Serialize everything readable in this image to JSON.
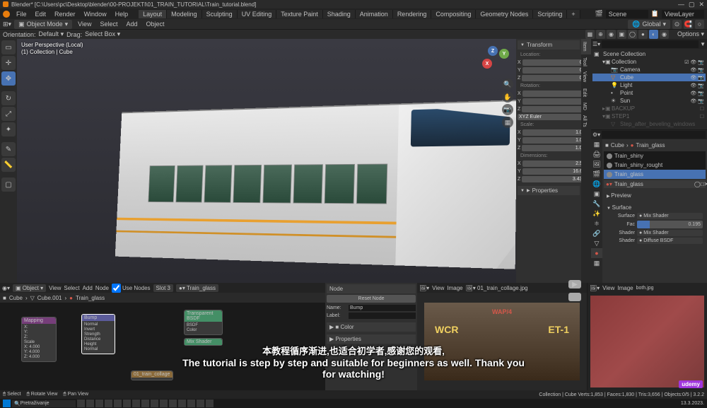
{
  "titlebar": {
    "path": "Blender* [C:\\Users\\pc\\Desktop\\blender\\00-PROJEKTI\\01_TRAIN_TUTORIAL\\Train_tutorial.blend]"
  },
  "topmenu": {
    "items": [
      "File",
      "Edit",
      "Render",
      "Window",
      "Help"
    ],
    "tabs": [
      "Layout",
      "Modeling",
      "Sculpting",
      "UV Editing",
      "Texture Paint",
      "Shading",
      "Animation",
      "Rendering",
      "Compositing",
      "Geometry Nodes",
      "Scripting"
    ],
    "active_tab": "Layout",
    "scene_label": "Scene",
    "viewlayer_label": "ViewLayer"
  },
  "secondbar": {
    "mode": "Object Mode",
    "menus": [
      "View",
      "Select",
      "Add",
      "Object"
    ],
    "global": "Global"
  },
  "thirdbar": {
    "orientation_label": "Orientation:",
    "orientation": "Default",
    "drag_label": "Drag:",
    "drag": "Select Box",
    "options": "Options"
  },
  "viewport": {
    "line1": "User Perspective (Local)",
    "line2": "(1) Collection | Cube"
  },
  "transform": {
    "header": "Transform",
    "location_label": "Location:",
    "location": {
      "x": "0 m",
      "y": "0 m",
      "z": "0 m"
    },
    "rotation_label": "Rotation:",
    "rotation": {
      "x": "0°",
      "y": "0°",
      "z": "0°"
    },
    "rotation_mode": "XYZ Euler",
    "scale_label": "Scale:",
    "scale": {
      "x": "1.000",
      "y": "1.000",
      "z": "1.000"
    },
    "dimensions_label": "Dimensions:",
    "dimensions": {
      "x": "2.5 m",
      "y": "16.6 m",
      "z": "3.43 m"
    },
    "properties_header": "Properties"
  },
  "outliner": {
    "scene_collection": "Scene Collection",
    "collection": "Collection",
    "items": [
      "Camera",
      "Cube",
      "Light",
      "Point",
      "Sun"
    ],
    "backup": "BACKUP",
    "step1": "STEP1",
    "step_after": "Step_after_beveling_windows",
    "search_placeholder": ""
  },
  "properties": {
    "breadcrumb_cube": "Cube",
    "breadcrumb_mat": "Train_glass",
    "materials": [
      "Train_shiny",
      "Train_shiny_rought",
      "Train_glass"
    ],
    "active_material": "Train_glass",
    "preview": "Preview",
    "surface_label": "Surface",
    "surface_value": "Mix Shader",
    "fac_label": "Fac",
    "fac_value": "0.195",
    "shader1_label": "Shader",
    "shader1_value": "Mix Shader",
    "shader2_label": "Shader",
    "shader2_value": "Diffuse BSDF"
  },
  "node_editor": {
    "mode": "Object",
    "menus": [
      "View",
      "Select",
      "Add",
      "Node"
    ],
    "use_nodes": "Use Nodes",
    "slot": "Slot 3",
    "material": "Train_glass",
    "breadcrumb": [
      "Cube",
      "Cube.001",
      "Train_glass"
    ],
    "sidebar_header": "Node",
    "reset_btn": "Reset Node",
    "name_label": "Name:",
    "name_value": "Bump",
    "label_label": "Label:",
    "label_value": "",
    "color_header": "Color",
    "properties_header": "Properties",
    "node1_title": "Bump",
    "node1_sockets": [
      "Normal",
      "Invert",
      "Strength",
      "Distance",
      "Height",
      "Normal"
    ],
    "node2_title": "Mapping",
    "node3_title": "Transparent BSDF",
    "node4_title": "Mix Shader"
  },
  "image_editor": {
    "menus": [
      "View",
      "Image"
    ],
    "image_name": "01_train_collage.jpg"
  },
  "image_editor2": {
    "menus": [
      "View",
      "Image"
    ],
    "image_name": "both.jpg"
  },
  "statusbar": {
    "select": "Select",
    "rotate": "Rotate View",
    "pan": "Pan View",
    "stats": "Collection | Cube    Verts:1,853 | Faces:1,830 | Tris:3,656 | Objects:0/5 | 3.2.2"
  },
  "taskbar": {
    "search": "Pretraživanje",
    "date": "13.3.2023."
  },
  "subtitles": {
    "zh": "本教程循序渐进,也适合初学者,感谢您的观看,",
    "en": "The tutorial is step by step and suitable for beginners as well. Thank you for watching!"
  },
  "udemy": "udemy"
}
